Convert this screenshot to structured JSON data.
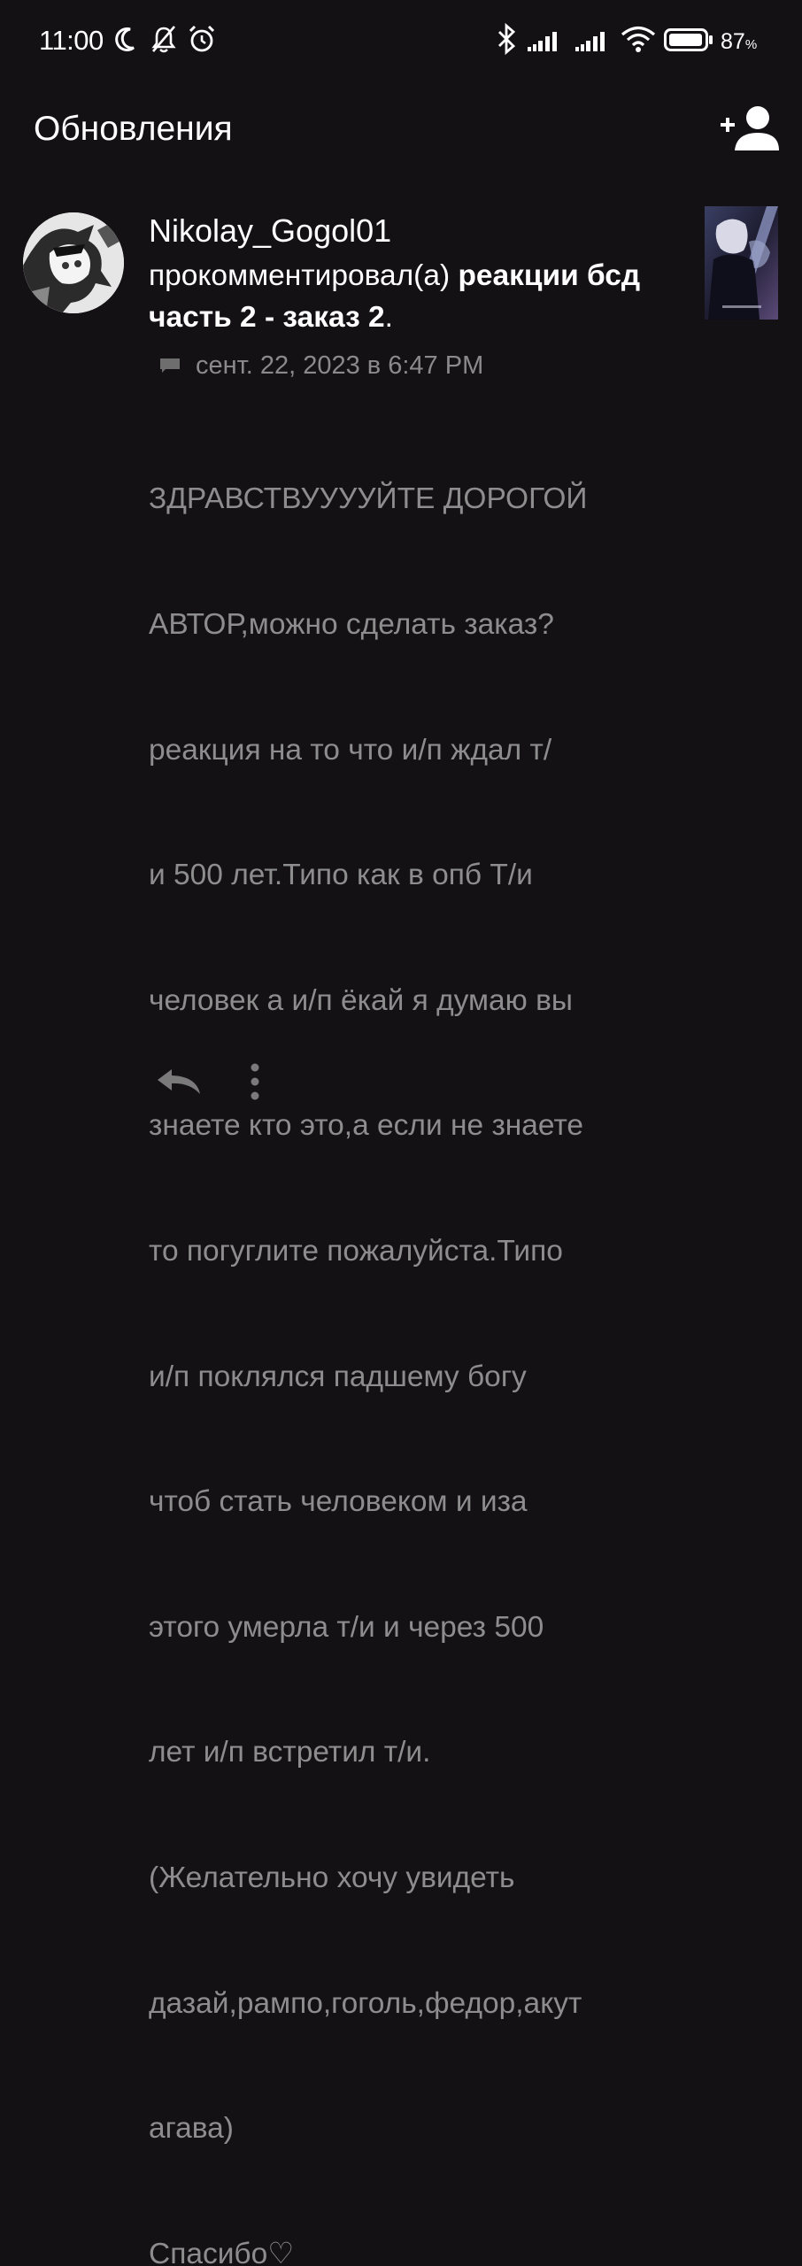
{
  "status_bar": {
    "time": "11:00",
    "battery_percent": "87",
    "battery_unit": "%",
    "icons": [
      "moon-icon",
      "bell-off-icon",
      "alarm-icon",
      "bluetooth-icon",
      "signal-icon",
      "signal-icon",
      "wifi-icon",
      "battery-icon"
    ]
  },
  "header": {
    "title": "Обновления",
    "action_icon": "add-user-icon"
  },
  "notification": {
    "username": "Nikolay_Gogol01",
    "action_text": "прокомментировал(а) ",
    "story_title": "реакции бсд часть 2 - заказ 2",
    "period": ".",
    "timestamp": "сент. 22, 2023 в 6:47 PM",
    "comment_lines": [
      "ЗДРАВСТВУУУУЙТЕ ДОРОГОЙ",
      "АВТОР,можно сделать заказ?",
      "реакция на то что и/п ждал т/",
      "и 500 лет.Типо как в опб Т/и",
      "человек а и/п ёкай я думаю вы",
      "знаете кто это,а если не знаете",
      "то погуглите пожалуйста.Типо",
      "и/п поклялся падшему богу",
      "чтоб стать человеком и иза",
      "этого умерла т/и и через 500",
      "лет и/п встретил т/и.",
      "(Желательно хочу увидеть",
      "дазай,рампо,гоголь,федор,акут",
      "агава)",
      "Спасибо♡"
    ]
  },
  "actions": {
    "reply_icon": "reply-icon",
    "more_icon": "more-vertical-icon"
  },
  "colors": {
    "background": "#141115",
    "primary_text": "#ffffff",
    "secondary_text": "#8d8d8d"
  }
}
